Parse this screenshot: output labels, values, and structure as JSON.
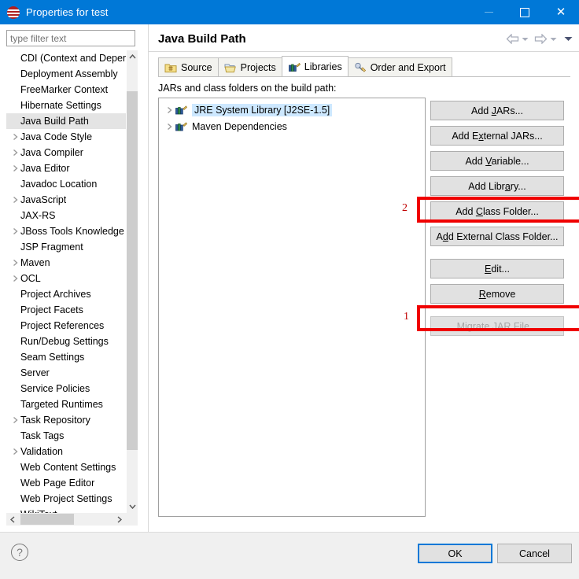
{
  "window": {
    "title": "Properties for test",
    "icon": "eclipse-properties-icon",
    "controls": {
      "minimize": "minimize-icon",
      "maximize": "maximize-icon",
      "close": "close-icon"
    }
  },
  "filter": {
    "value": "",
    "placeholder": "type filter text"
  },
  "sidebar": {
    "items": [
      {
        "label": "CDI (Context and Dependency",
        "expandable": false
      },
      {
        "label": "Deployment Assembly",
        "expandable": false
      },
      {
        "label": "FreeMarker Context",
        "expandable": false
      },
      {
        "label": "Hibernate Settings",
        "expandable": false
      },
      {
        "label": "Java Build Path",
        "expandable": false,
        "selected": true
      },
      {
        "label": "Java Code Style",
        "expandable": true
      },
      {
        "label": "Java Compiler",
        "expandable": true
      },
      {
        "label": "Java Editor",
        "expandable": true
      },
      {
        "label": "Javadoc Location",
        "expandable": false
      },
      {
        "label": "JavaScript",
        "expandable": true
      },
      {
        "label": "JAX-RS",
        "expandable": false
      },
      {
        "label": "JBoss Tools Knowledge",
        "expandable": true
      },
      {
        "label": "JSP Fragment",
        "expandable": false
      },
      {
        "label": "Maven",
        "expandable": true
      },
      {
        "label": "OCL",
        "expandable": true
      },
      {
        "label": "Project Archives",
        "expandable": false
      },
      {
        "label": "Project Facets",
        "expandable": false
      },
      {
        "label": "Project References",
        "expandable": false
      },
      {
        "label": "Run/Debug Settings",
        "expandable": false
      },
      {
        "label": "Seam Settings",
        "expandable": false
      },
      {
        "label": "Server",
        "expandable": false
      },
      {
        "label": "Service Policies",
        "expandable": false
      },
      {
        "label": "Targeted Runtimes",
        "expandable": false
      },
      {
        "label": "Task Repository",
        "expandable": true
      },
      {
        "label": "Task Tags",
        "expandable": false
      },
      {
        "label": "Validation",
        "expandable": true
      },
      {
        "label": "Web Content Settings",
        "expandable": false
      },
      {
        "label": "Web Page Editor",
        "expandable": false
      },
      {
        "label": "Web Project Settings",
        "expandable": false
      },
      {
        "label": "WikiText",
        "expandable": false
      }
    ]
  },
  "page": {
    "title": "Java Build Path",
    "nav": {
      "back": "back-arrow-icon",
      "back_menu": "chevron-down-icon",
      "forward": "forward-arrow-icon",
      "forward_menu": "chevron-down-icon",
      "view_menu": "chevron-down-icon"
    },
    "tabs": [
      {
        "label": "Source",
        "icon": "source-folder-icon",
        "active": false
      },
      {
        "label": "Projects",
        "icon": "projects-folder-icon",
        "active": false
      },
      {
        "label": "Libraries",
        "icon": "libraries-icon",
        "active": true
      },
      {
        "label": "Order and Export",
        "icon": "order-export-icon",
        "active": false
      }
    ],
    "section_label": "JARs and class folders on the build path:",
    "entries": [
      {
        "label": "JRE System Library [J2SE-1.5]",
        "icon": "library-icon",
        "selected": true
      },
      {
        "label": "Maven Dependencies",
        "icon": "library-icon",
        "selected": false
      }
    ],
    "buttons": [
      {
        "label": "Add JARs...",
        "mnemonic": "J",
        "disabled": false
      },
      {
        "label": "Add External JARs...",
        "mnemonic": "x",
        "disabled": false
      },
      {
        "label": "Add Variable...",
        "mnemonic": "V",
        "disabled": false
      },
      {
        "label": "Add Library...",
        "mnemonic": "a",
        "disabled": false
      },
      {
        "label": "Add Class Folder...",
        "mnemonic": "C",
        "disabled": false
      },
      {
        "label": "Add External Class Folder...",
        "mnemonic": "d",
        "disabled": false
      },
      {
        "label": "Edit...",
        "mnemonic": "E",
        "disabled": false
      },
      {
        "label": "Remove",
        "mnemonic": "R",
        "disabled": false
      },
      {
        "label": "Migrate JAR File...",
        "mnemonic": "M",
        "disabled": true
      }
    ]
  },
  "annotations": [
    {
      "number": "2",
      "target": "Add Library...",
      "color": "#f00000"
    },
    {
      "number": "1",
      "target": "Remove",
      "color": "#f00000"
    }
  ],
  "footer": {
    "help": "help-icon",
    "ok_label": "OK",
    "cancel_label": "Cancel"
  },
  "colors": {
    "titlebar": "#0078d7",
    "selection": "#cde8ff",
    "annotation": "#f00000",
    "button_face": "#e1e1e1"
  }
}
